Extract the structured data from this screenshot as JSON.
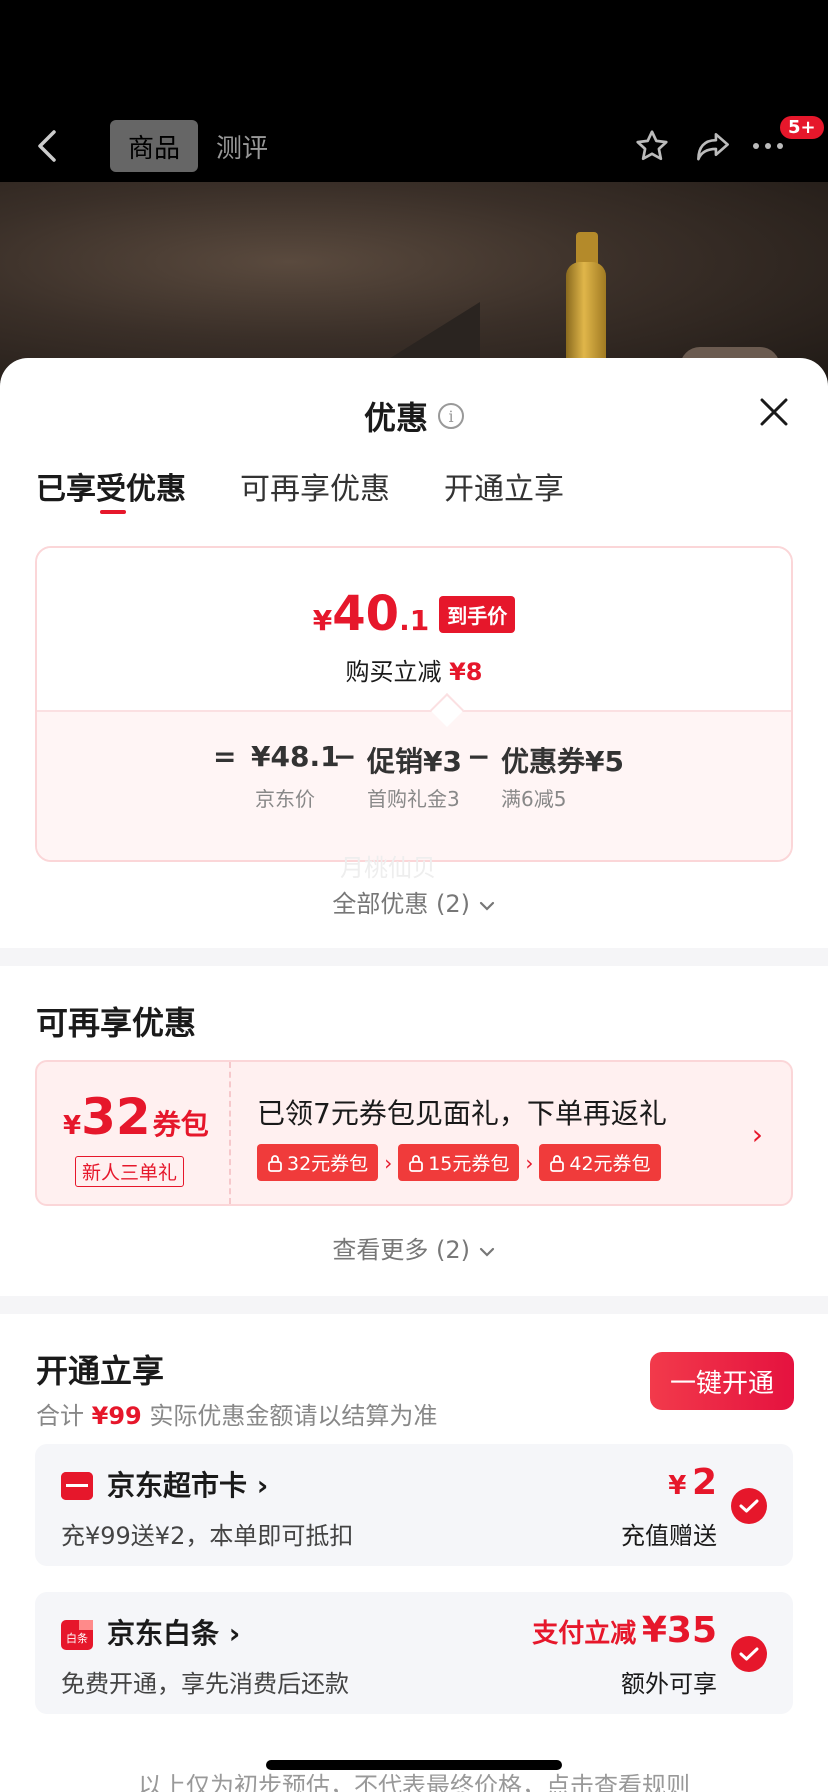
{
  "nav": {
    "tab_goods": "商品",
    "tab_review": "测评",
    "badge": "5+"
  },
  "sheet": {
    "title": "优惠",
    "tabs": [
      "已享受优惠",
      "可再享优惠",
      "开通立享"
    ]
  },
  "price_card": {
    "currency": "¥",
    "final_int": "40",
    "final_dec": ".1",
    "final_tag": "到手价",
    "instant_label": "购买立减",
    "instant_value": "¥8",
    "eq": "=",
    "base_value": "¥48.1",
    "minus1": "−",
    "promo_value": "促销¥3",
    "minus2": "−",
    "coupon_value": "优惠券¥5",
    "base_label": "京东价",
    "promo_label": "首购礼金3",
    "coupon_label": "满6减5"
  },
  "watermark": "月桃仙贝",
  "all_discounts": "全部优惠 (2)",
  "more_section": {
    "title": "可再享优惠",
    "coupon": {
      "currency": "¥",
      "amount": "32",
      "unit": "券包",
      "sub": "新人三单礼",
      "desc": "已领7元券包见面礼，下单再返礼",
      "packs": [
        "32元券包",
        "15元券包",
        "42元券包"
      ]
    },
    "see_more": "查看更多 (2)"
  },
  "open_section": {
    "title": "开通立享",
    "total_label": "合计",
    "total_value": "¥99",
    "note": "实际优惠金额请以结算为准",
    "button": "一键开通",
    "items": [
      {
        "name": "京东超市卡",
        "desc": "充¥99送¥2，本单即可抵扣",
        "amount_prefix": "¥",
        "amount": "2",
        "sub": "充值赠送"
      },
      {
        "name": "京东白条",
        "icon_text": "白条",
        "desc": "免费开通，享先消费后还款",
        "amount_prefix": "支付立减",
        "amount": "¥35",
        "sub": "额外可享"
      }
    ]
  },
  "disclaimer": "以上仅为初步预估，不代表最终价格，点击查看规则",
  "colors": {
    "accent": "#e6172b",
    "pink_border": "#fbd6d8",
    "card_bg": "#f5f6f9"
  }
}
